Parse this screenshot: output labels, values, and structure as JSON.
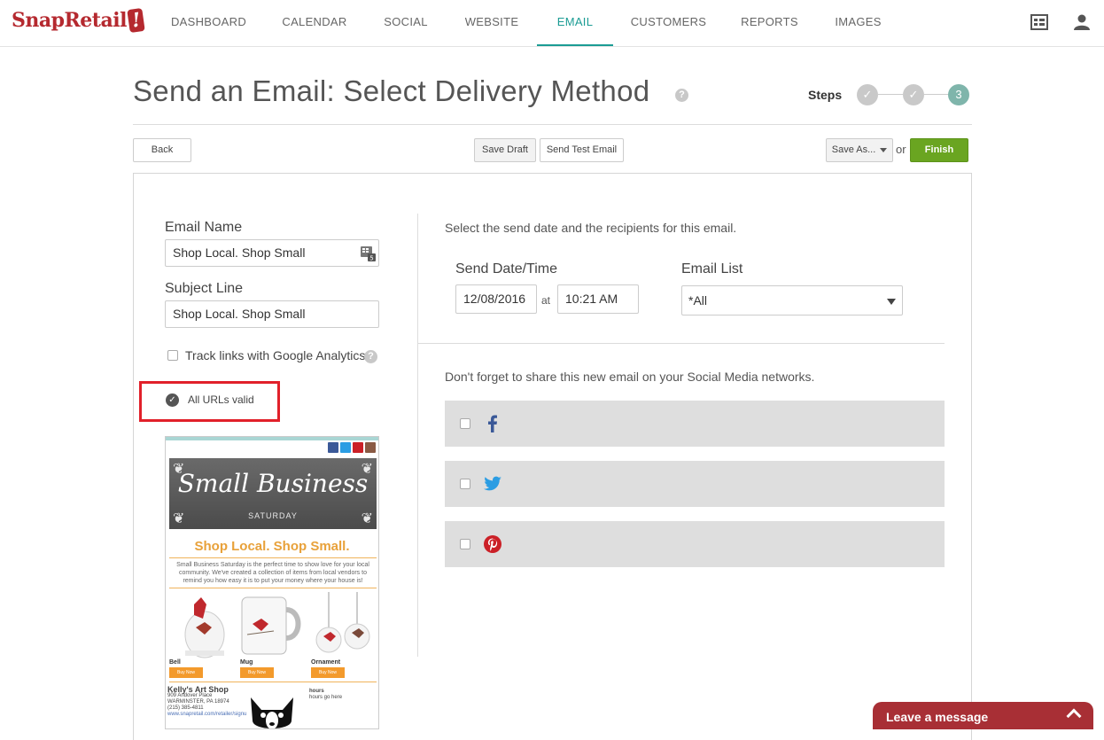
{
  "brand": {
    "name": "SnapRetail",
    "mark": "!"
  },
  "nav": {
    "items": [
      {
        "label": "DASHBOARD"
      },
      {
        "label": "CALENDAR"
      },
      {
        "label": "SOCIAL"
      },
      {
        "label": "WEBSITE"
      },
      {
        "label": "EMAIL",
        "active": true
      },
      {
        "label": "CUSTOMERS"
      },
      {
        "label": "REPORTS"
      },
      {
        "label": "IMAGES"
      }
    ],
    "icons": [
      "calendar-grid-icon",
      "user-icon"
    ]
  },
  "header": {
    "title": "Send an Email: Select Delivery Method",
    "help": "?",
    "steps_label": "Steps",
    "steps": [
      "✓",
      "✓",
      "3"
    ]
  },
  "toolbar": {
    "back": "Back",
    "save_draft": "Save Draft",
    "send_test": "Send Test Email",
    "save_as": "Save As...",
    "or": "or",
    "finish": "Finish"
  },
  "form": {
    "email_name_label": "Email Name",
    "email_name_value": "Shop Local. Shop Small",
    "subject_label": "Subject Line",
    "subject_value": "Shop Local. Shop Small",
    "track_label": "Track links with Google Analytics",
    "track_checked": false,
    "url_status": "All URLs valid"
  },
  "preview": {
    "banner_title": "Small Business",
    "banner_sub": "SATURDAY",
    "headline": "Shop Local. Shop Small.",
    "blurb": "Small Business Saturday is the perfect time to show love for your local community. We've created a collection of items from local vendors to remind you how easy it is to put your money where your house is!",
    "products": [
      {
        "name": "Bell",
        "button": "Buy Now"
      },
      {
        "name": "Mug",
        "button": "Buy Now"
      },
      {
        "name": "Ornament",
        "button": "Buy Now"
      }
    ],
    "shop_name": "Kelly's Art Shop",
    "shop_address1": "909 Andover Place",
    "shop_address2": "WARMINSTER, PA 18974",
    "shop_phone": "(215) 385-4811",
    "shop_url": "www.snapretail.com/retailer/signu",
    "hours_label": "hours",
    "hours_value": "hours go here"
  },
  "delivery": {
    "intro": "Select the send date and the recipients for this email.",
    "send_label": "Send Date/Time",
    "date": "12/08/2016",
    "at": "at",
    "time": "10:21 AM",
    "list_label": "Email List",
    "list_value": "*All"
  },
  "share": {
    "text": "Don't forget to share this new email on your Social Media networks.",
    "networks": [
      {
        "icon": "facebook-icon",
        "color": "#3b5998",
        "checked": false
      },
      {
        "icon": "twitter-icon",
        "color": "#2b9de3",
        "checked": false
      },
      {
        "icon": "pinterest-icon",
        "color": "#cb2027",
        "checked": false
      }
    ]
  },
  "chat": {
    "label": "Leave a message"
  },
  "colors": {
    "accent": "#1b9c94",
    "brand": "#b5292f",
    "finish": "#6aa521",
    "highlight": "#e1202a",
    "chat": "#a82f35"
  }
}
